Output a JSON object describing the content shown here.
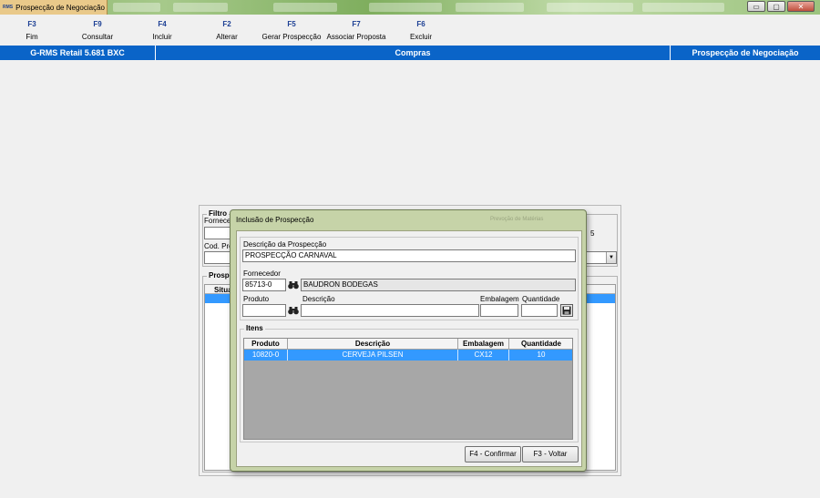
{
  "window": {
    "logo_text": "RMS",
    "title": "Prospecção de Negociação",
    "minimize_glyph": "▭",
    "maximize_glyph": "▢",
    "close_glyph": "✕"
  },
  "toolbar": [
    {
      "key": "F3",
      "label": "Fim"
    },
    {
      "key": "F9",
      "label": "Consultar"
    },
    {
      "key": "F4",
      "label": "Incluir"
    },
    {
      "key": "F2",
      "label": "Alterar"
    },
    {
      "key": "F5",
      "label": "Gerar Prospecção"
    },
    {
      "key": "F7",
      "label": "Associar Proposta"
    },
    {
      "key": "F6",
      "label": "Excluir"
    }
  ],
  "statusbar": {
    "app": "G-RMS Retail 5.681 BXC",
    "module": "Compras",
    "screen": "Prospecção de Negociação"
  },
  "bgform": {
    "filter_title": "Filtro",
    "fornecedor_label": "Fornecec",
    "cod_label": "Cod. Pro",
    "right_value": "5",
    "prospect_title": "Prospe",
    "situacao_label": "Situaç"
  },
  "dialog": {
    "title": "Inclusão de Prospecção",
    "hint": "Prevoção de Matérias",
    "descricao_label": "Descrição da Prospecção",
    "descricao_value": "PROSPECÇÃO CARNAVAL",
    "fornecedor_label": "Fornecedor",
    "fornecedor_code": "85713-0",
    "fornecedor_name": "BAUDRON BODEGAS",
    "produto_label": "Produto",
    "descricao2_label": "Descrição",
    "embalagem_label": "Embalagem",
    "quantidade_label": "Quantidade",
    "produto_value": "",
    "descricao2_value": "",
    "embalagem_value": "",
    "quantidade_value": "",
    "itens_title": "Itens",
    "columns": [
      "Produto",
      "Descrição",
      "Embalagem",
      "Quantidade"
    ],
    "rows": [
      {
        "produto": "10820-0",
        "descricao": "CERVEJA PILSEN",
        "embalagem": "CX12",
        "quantidade": "10"
      }
    ],
    "confirm_label": "F4 - Confirmar",
    "back_label": "F3 - Voltar"
  }
}
